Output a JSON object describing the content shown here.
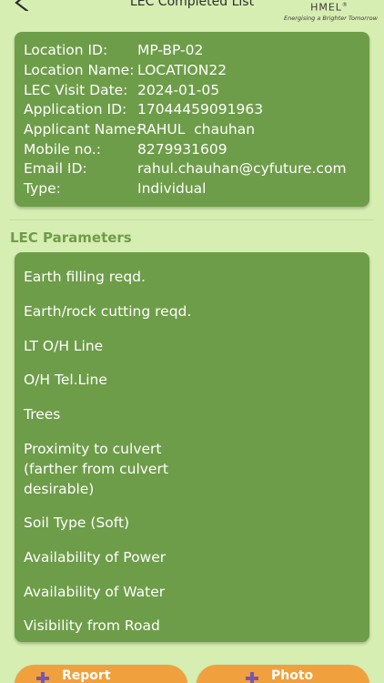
{
  "header": {
    "title": "LEC Completed List",
    "logo_text": "HMEL",
    "logo_tagline": "Energising a Brighter Tomorrow"
  },
  "details": [
    {
      "label": "Location ID:",
      "value": "MP-BP-02"
    },
    {
      "label": "Location Name:",
      "value": "LOCATION22"
    },
    {
      "label": "LEC Visit Date:",
      "value": "2024-01-05"
    },
    {
      "label": "Application ID:",
      "value": "17044459091963"
    },
    {
      "label": "Applicant Name:",
      "value": "RAHUL  chauhan"
    },
    {
      "label": "Mobile no.:",
      "value": "8279931609"
    },
    {
      "label": "Email ID:",
      "value": "rahul.chauhan@cyfuture.com"
    },
    {
      "label": "Type:",
      "value": "Individual"
    }
  ],
  "section": {
    "title": "LEC Parameters"
  },
  "parameters": [
    "Earth filling reqd.",
    "Earth/rock cutting reqd.",
    "LT O/H Line",
    "O/H Tel.Line",
    "Trees",
    "Proximity to culvert (farther from culvert desirable)",
    "Soil Type (Soft)",
    "Availability of Power",
    "Availability of Water",
    "Visibility from Road"
  ],
  "buttons": {
    "report_label": "Report",
    "photo_label": "Photo"
  },
  "colors": {
    "background": "#d7eeb2",
    "card": "#6e9d49",
    "accent_button": "#f0a03c",
    "section_title": "#6e9d49"
  },
  "icons": {
    "back": "arrow-left-icon",
    "button": "plus-icon"
  }
}
